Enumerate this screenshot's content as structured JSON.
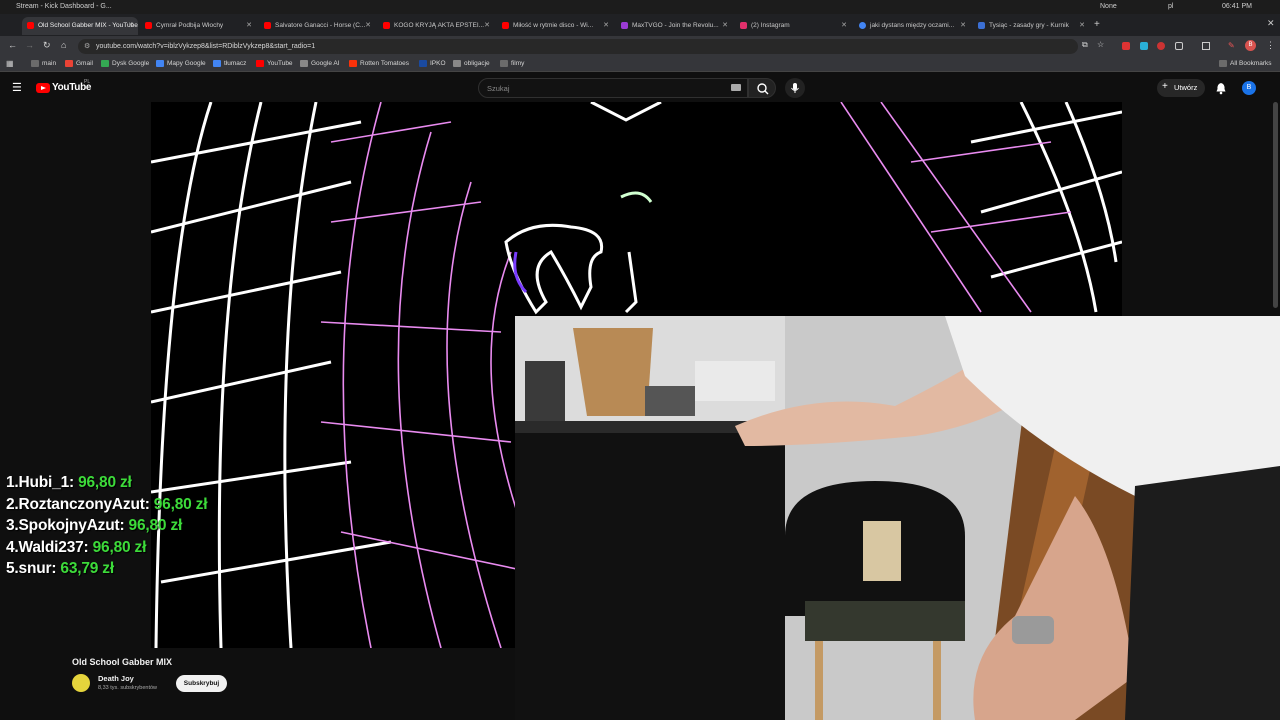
{
  "os_bar": {
    "window_title": "Stream - Kick Dashboard - G...",
    "status_none": "None",
    "language": "pl",
    "clock": "06:41 PM"
  },
  "tabs": [
    {
      "label": "Old School Gabber MIX - YouTube",
      "color": "#ff0000",
      "active": true
    },
    {
      "label": "Cymrał Podbija Włochy",
      "color": "#ff0000",
      "active": false
    },
    {
      "label": "Salvatore Ganacci - Horse (C...",
      "color": "#ff0000",
      "active": false
    },
    {
      "label": "KOGO KRYJĄ AKTA EPSTEI...",
      "color": "#ff0000",
      "active": false
    },
    {
      "label": "Miłość w rytmie disco - Wi...",
      "color": "#ff0000",
      "active": false
    },
    {
      "label": "MaxTVGO - Join the Revolu...",
      "color": "#9b3bd4",
      "active": false
    },
    {
      "label": "(2) Instagram",
      "color": "#e1306c",
      "active": false
    },
    {
      "label": "jaki dystans między oczami...",
      "color": "#4285f4",
      "active": false
    },
    {
      "label": "Tysiąc - zasady gry - Kurnik",
      "color": "#3b6fd4",
      "active": false
    }
  ],
  "address": {
    "url": "youtube.com/watch?v=iblzVykzep8&list=RDiblzVykzep8&start_radio=1"
  },
  "bookmarks": [
    {
      "label": "main",
      "color": "#6b6b6b"
    },
    {
      "label": "Gmail",
      "color": "#ea4335"
    },
    {
      "label": "Dysk Google",
      "color": "#34a853"
    },
    {
      "label": "Mapy Google",
      "color": "#4285f4"
    },
    {
      "label": "tłumacz",
      "color": "#4285f4"
    },
    {
      "label": "YouTube",
      "color": "#ff0000"
    },
    {
      "label": "Google AI",
      "color": "#888888"
    },
    {
      "label": "Rotten Tomatoes",
      "color": "#fa320a"
    },
    {
      "label": "IPKO",
      "color": "#1a4aa0"
    },
    {
      "label": "obligacje",
      "color": "#888888"
    },
    {
      "label": "filmy",
      "color": "#6b6b6b"
    }
  ],
  "all_bookmarks": "All Bookmarks",
  "youtube": {
    "logo_text": "YouTube",
    "logo_region": "PL",
    "search_placeholder": "Szukaj",
    "create_label": "Utwórz",
    "avatar_letter": "B"
  },
  "leaderboard": [
    {
      "rank": "1.",
      "name": "Hubi_1:",
      "amount": "96,80 zł"
    },
    {
      "rank": "2.",
      "name": "RoztanczonyAzut:",
      "amount": "96,80 zł"
    },
    {
      "rank": "3.",
      "name": "SpokojnyAzut:",
      "amount": "96,80 zł"
    },
    {
      "rank": "4.",
      "name": "Waldi237:",
      "amount": "96,80 zł"
    },
    {
      "rank": "5.",
      "name": "snur:",
      "amount": "63,79 zł"
    }
  ],
  "video_info": {
    "title": "Old School Gabber MIX",
    "channel": "Death Joy",
    "subscribers": "8,33 tys. subskrybentów",
    "subscribe_label": "Subskrybuj"
  }
}
